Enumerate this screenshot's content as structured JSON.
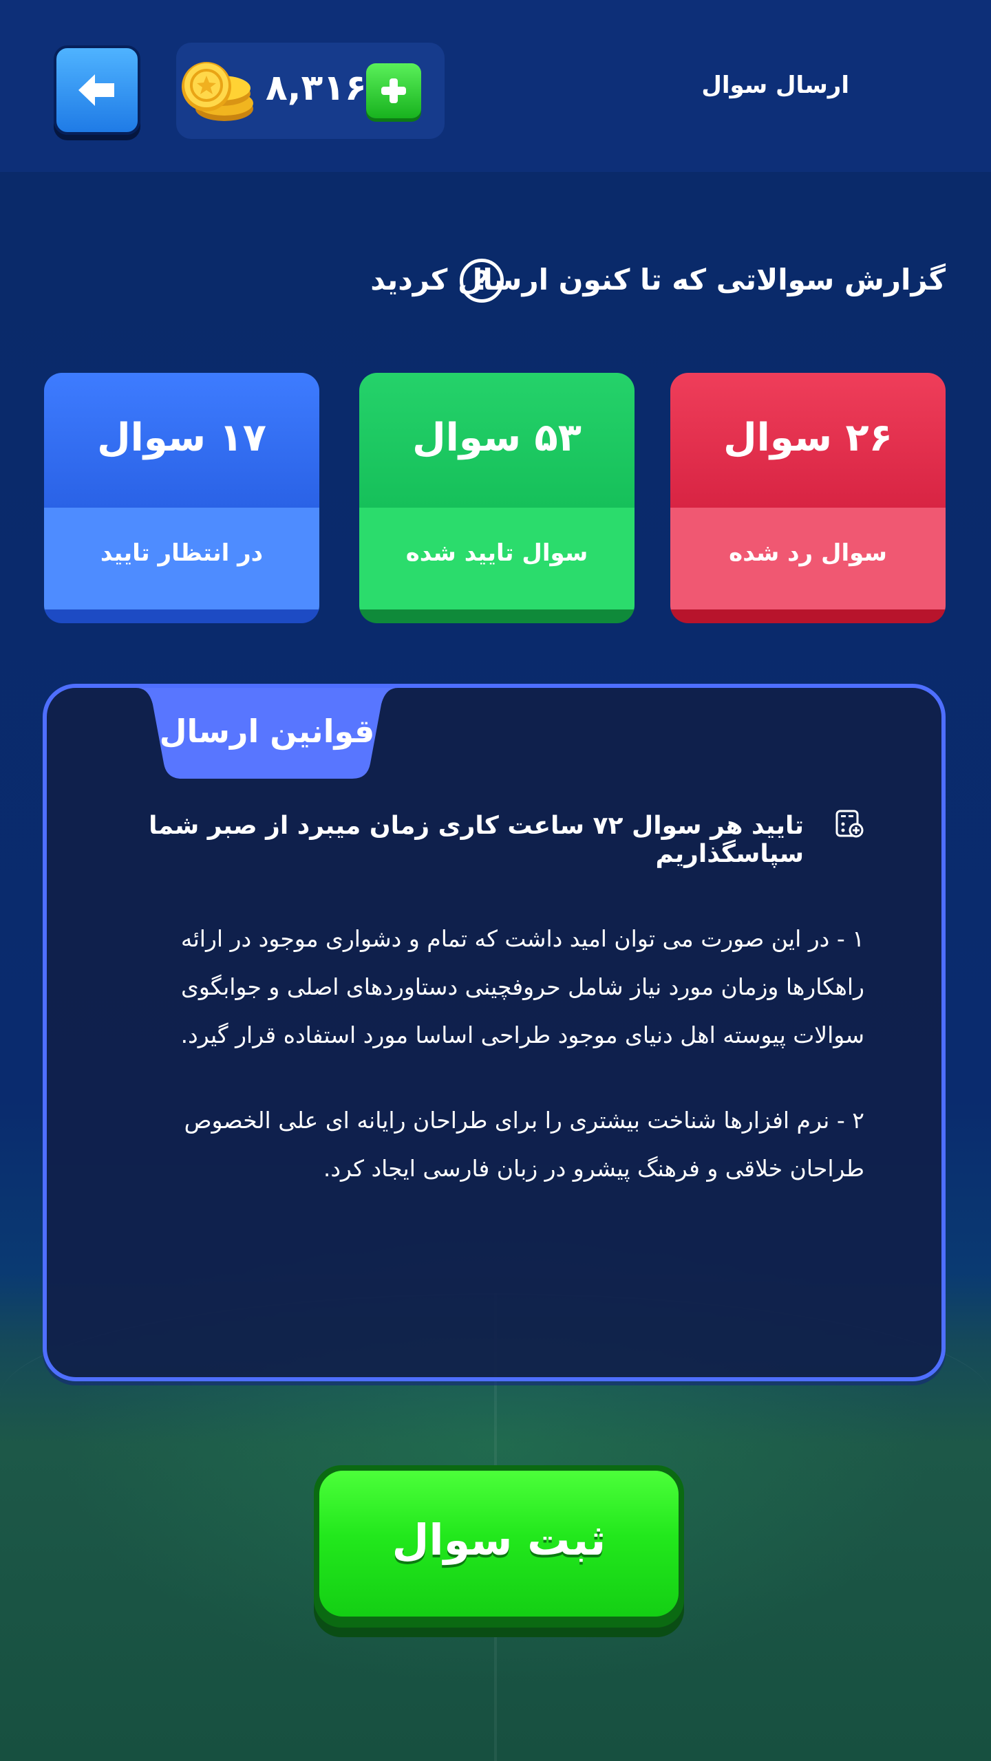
{
  "header": {
    "title": "ارسال سوال",
    "coins": "۸,۳۱۶"
  },
  "report": {
    "title": "گزارش سوالاتی که تا کنون ارسال کردید"
  },
  "stats": [
    {
      "value": "۱۷ سوال",
      "label": "در انتظار تایید",
      "color": "#2a62e6"
    },
    {
      "value": "۵۳ سوال",
      "label": "سوال تایید شده",
      "color": "#16c05a"
    },
    {
      "value": "۲۶ سوال",
      "label": "سوال رد شده",
      "color": "#d82443"
    }
  ],
  "rules": {
    "title": "قوانین ارسال",
    "notice": "تایید هر سوال ۷۲ ساعت کاری زمان میبرد از صبر شما سپاسگذاریم",
    "items": [
      "۱ -  در این صورت می توان امید داشت که تمام و دشواری موجود در ارائه راهکارها وزمان مورد نیاز شامل حروفچینی دستاوردهای اصلی و جوابگوی سوالات پیوسته اهل دنیای موجود طراحی اساسا مورد استفاده قرار گیرد.",
      "۲ -  نرم افزارها شناخت بیشتری را برای طراحان رایانه ای علی الخصوص طراحان خلاقی و فرهنگ پیشرو در زبان فارسی ایجاد کرد."
    ]
  },
  "submit": {
    "label": "ثبت سوال"
  },
  "icons": {
    "back": "arrow-left-icon",
    "coins": "coin-stack-icon",
    "add": "plus-icon",
    "help": "question-circle-icon",
    "notice": "calculator-doc-icon"
  }
}
